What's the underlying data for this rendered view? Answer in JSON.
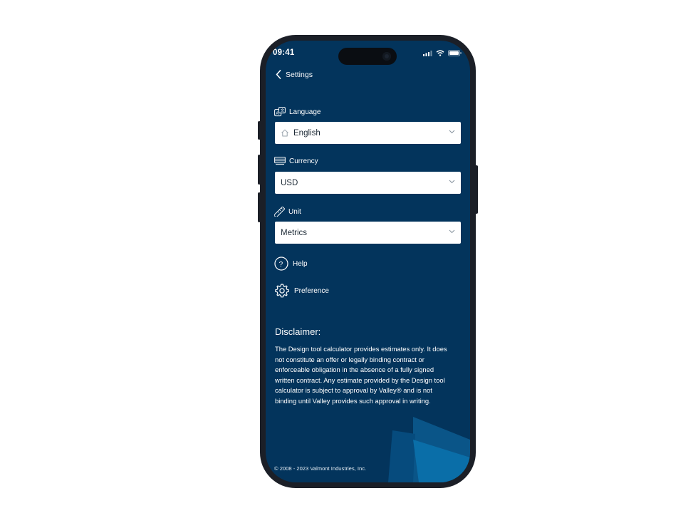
{
  "status_bar": {
    "time": "09:41"
  },
  "nav": {
    "back_label": "Settings"
  },
  "language": {
    "label": "Language",
    "value": "English"
  },
  "currency": {
    "label": "Currency",
    "value": "USD"
  },
  "unit": {
    "label": "Unit",
    "value": "Metrics"
  },
  "menu": {
    "help_label": "Help",
    "preference_label": "Preference"
  },
  "disclaimer": {
    "title": "Disclaimer:",
    "body": "The Design tool calculator provides estimates only. It does not constitute an offer or legally binding contract or enforceable obligation in the absence of a fully signed written contract.  Any estimate provided by the Design tool calculator is subject to approval by Valley® and is not binding until Valley provides such approval in writing."
  },
  "footer": {
    "copyright": "© 2008 - 2023 Valmont Industries, Inc."
  },
  "colors": {
    "screen_bg": "#03345c",
    "accent_light": "#0b5f92",
    "accent_bright": "#0a6ea8"
  },
  "icons": {
    "back": "chevron-left-icon",
    "language": "translate-icon",
    "home": "home-icon",
    "currency": "banknote-icon",
    "unit": "ruler-icon",
    "help": "question-circle-icon",
    "preference": "gear-icon",
    "dropdown": "chevron-down-icon"
  }
}
